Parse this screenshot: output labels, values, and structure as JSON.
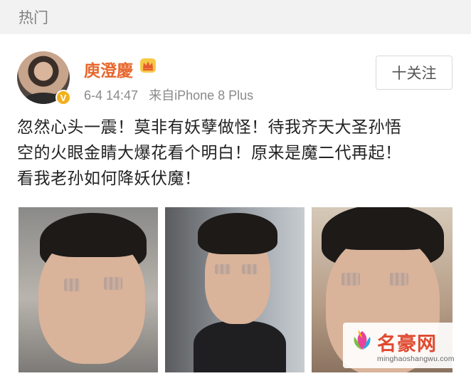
{
  "header": {
    "title": "热门"
  },
  "post": {
    "author": "庾澄慶",
    "verified_badge": "V",
    "date": "6-4 14:47",
    "source": "来自iPhone 8 Plus",
    "follow_label": "十关注",
    "text_lines": [
      "忽然心头一震！莫非有妖孽做怪！待我齐天大圣孙悟",
      "空的火眼金睛大爆花看个明白！原来是魔二代再起！",
      "看我老孙如何降妖伏魔！"
    ],
    "photos": [
      "photo-1",
      "photo-2",
      "photo-3"
    ]
  },
  "watermark": {
    "title": "名豪网",
    "url": "minghaoshangwu.com"
  },
  "colors": {
    "username": "#e8662c",
    "badge": "#f2b01e",
    "watermark": "#e04a2f"
  },
  "icons": [
    "crown-icon",
    "verified-icon",
    "site-logo-icon"
  ]
}
